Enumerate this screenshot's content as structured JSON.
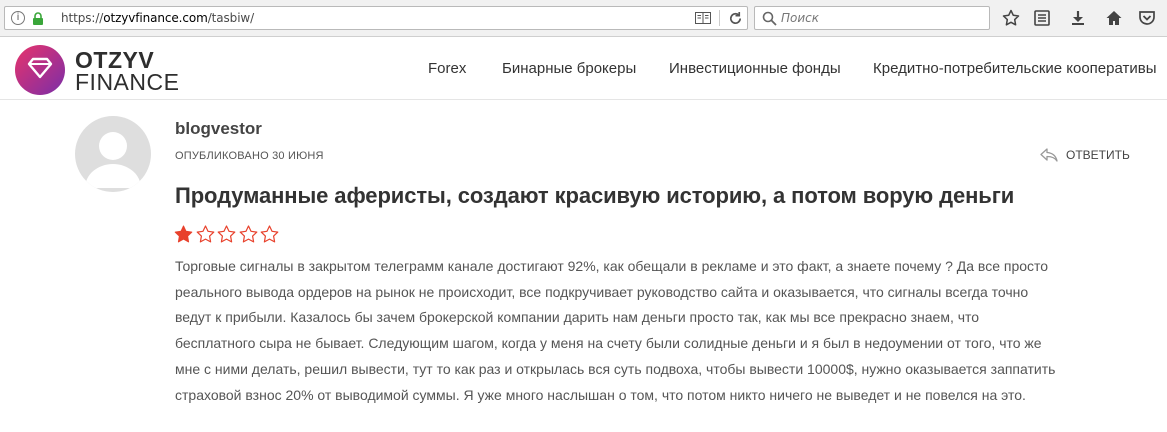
{
  "browser": {
    "url_prefix": "https://",
    "url_host": "otzyvfinance.com",
    "url_path": "/tasbiw/",
    "search_placeholder": "Поиск"
  },
  "site": {
    "logo_line1": "OTZYV",
    "logo_line2": "FINANCE",
    "nav": [
      "Forex",
      "Бинарные брокеры",
      "Инвестиционные фонды",
      "Кредитно-потребительские кооперативы"
    ]
  },
  "comment": {
    "author": "blogvestor",
    "published": "ОПУБЛИКОВАНО 30 ИЮНЯ",
    "reply_label": "ОТВЕТИТЬ",
    "title": "Продуманные аферисты, создают красивую историю, а потом ворую деньги",
    "rating": 1,
    "rating_max": 5,
    "body_lines": [
      "Торговые сигналы в закрытом телеграмм канале достигают 92%, как обещали в рекламе и это факт, а знаете почему ? Да все просто",
      "реального вывода ордеров на рынок не происходит, все подкручивает руководство сайта и оказывается, что сигналы всегда точно",
      "ведут к прибыли. Казалось бы зачем брокерской компании дарить нам деньги просто так, как мы все прекрасно знаем, что",
      "бесплатного сыра не бывает. Следующим шагом, когда у меня на счету были солидные деньги и я был в недоумении от того, что же",
      "мне с ними делать, решил вывести, тут то как раз и открылась вся суть подвоха, чтобы вывести 10000$, нужно оказывается заппатить",
      "страховой взнос 20% от выводимой суммы. Я уже много наслышан о том, что потом никто ничего не выведет и не повелся на это."
    ]
  },
  "colors": {
    "star_filled": "#e8412c",
    "star_empty": "#e8412c",
    "logo_gradient_start": "#e8336b",
    "logo_gradient_end": "#7a2ea8"
  }
}
